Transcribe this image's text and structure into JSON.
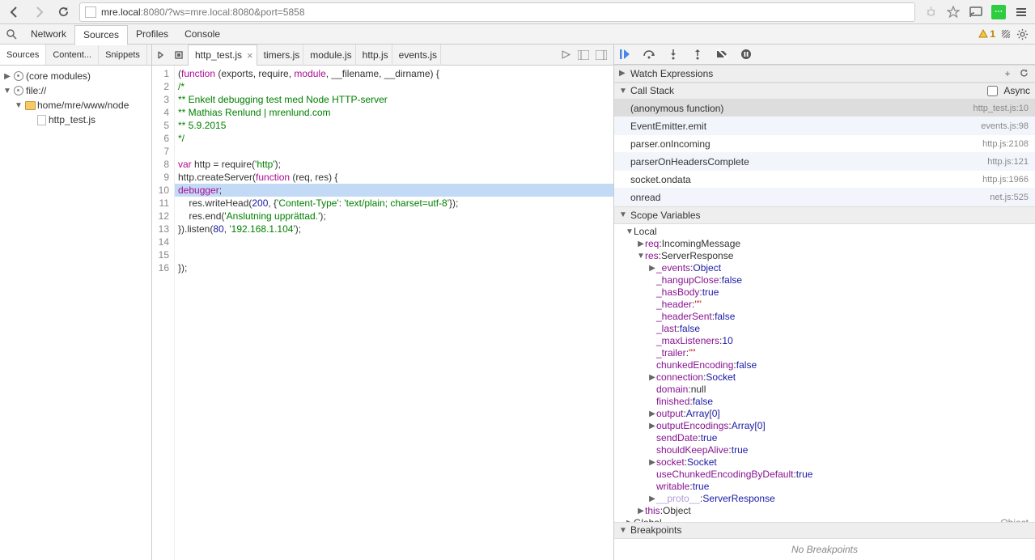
{
  "chrome": {
    "url_host": "mre.local",
    "url_rest": ":8080/?ws=mre.local:8080&port=5858"
  },
  "devtools": {
    "tabs": [
      "Network",
      "Sources",
      "Profiles",
      "Console"
    ],
    "active_tab": "Sources",
    "warn_count": "1"
  },
  "left_panel": {
    "tabs": [
      "Sources",
      "Content...",
      "Snippets"
    ],
    "tree": {
      "core": "(core modules)",
      "file_scheme": "file://",
      "folder_path": "home/mre/www/node",
      "file": "http_test.js"
    }
  },
  "editor": {
    "tabs": [
      "http_test.js",
      "timers.js",
      "module.js",
      "http.js",
      "events.js"
    ],
    "active_tab": "http_test.js",
    "highlighted_line": 10,
    "lines": [
      {
        "n": 1,
        "tokens": [
          [
            "(",
            "p"
          ],
          [
            "function",
            "kw"
          ],
          [
            " (exports, require, ",
            "p"
          ],
          [
            "module",
            "mod"
          ],
          [
            ", __filename, __dirname) {",
            "p"
          ]
        ]
      },
      {
        "n": 2,
        "tokens": [
          [
            "/*",
            "cm"
          ]
        ]
      },
      {
        "n": 3,
        "tokens": [
          [
            "** Enkelt debugging test med Node HTTP-server",
            "cm"
          ]
        ]
      },
      {
        "n": 4,
        "tokens": [
          [
            "** Mathias Renlund | mrenlund.com",
            "cm"
          ]
        ]
      },
      {
        "n": 5,
        "tokens": [
          [
            "** 5.9.2015",
            "cm"
          ]
        ]
      },
      {
        "n": 6,
        "tokens": [
          [
            "*/",
            "cm"
          ]
        ]
      },
      {
        "n": 7,
        "tokens": [
          [
            "",
            "p"
          ]
        ]
      },
      {
        "n": 8,
        "tokens": [
          [
            "var",
            "kw"
          ],
          [
            " http = require(",
            "p"
          ],
          [
            "'http'",
            "str"
          ],
          [
            ");",
            "p"
          ]
        ]
      },
      {
        "n": 9,
        "tokens": [
          [
            "http.createServer(",
            "p"
          ],
          [
            "function",
            "kw"
          ],
          [
            " (req, res) {",
            "p"
          ]
        ]
      },
      {
        "n": 10,
        "tokens": [
          [
            "debugger",
            "kw"
          ],
          [
            ";",
            "p"
          ]
        ]
      },
      {
        "n": 11,
        "tokens": [
          [
            "    res.writeHead(",
            "p"
          ],
          [
            "200",
            "num"
          ],
          [
            ", {",
            "p"
          ],
          [
            "'Content-Type'",
            "str"
          ],
          [
            ": ",
            "p"
          ],
          [
            "'text/plain; charset=utf-8'",
            "str"
          ],
          [
            "});",
            "p"
          ]
        ]
      },
      {
        "n": 12,
        "tokens": [
          [
            "    res.end(",
            "p"
          ],
          [
            "'Anslutning upprättad.'",
            "str"
          ],
          [
            ");",
            "p"
          ]
        ]
      },
      {
        "n": 13,
        "tokens": [
          [
            "}).listen(",
            "p"
          ],
          [
            "80",
            "num"
          ],
          [
            ", ",
            "p"
          ],
          [
            "'192.168.1.104'",
            "str"
          ],
          [
            ");",
            "p"
          ]
        ]
      },
      {
        "n": 14,
        "tokens": [
          [
            "",
            "p"
          ]
        ]
      },
      {
        "n": 15,
        "tokens": [
          [
            "",
            "p"
          ]
        ]
      },
      {
        "n": 16,
        "tokens": [
          [
            "});",
            "p"
          ]
        ]
      }
    ]
  },
  "right_panel": {
    "watch_label": "Watch Expressions",
    "callstack_label": "Call Stack",
    "async_label": "Async",
    "callstack": [
      {
        "fn": "(anonymous function)",
        "loc": "http_test.js:10",
        "active": true
      },
      {
        "fn": "EventEmitter.emit",
        "loc": "events.js:98"
      },
      {
        "fn": "parser.onIncoming",
        "loc": "http.js:2108"
      },
      {
        "fn": "parserOnHeadersComplete",
        "loc": "http.js:121"
      },
      {
        "fn": "socket.ondata",
        "loc": "http.js:1966"
      },
      {
        "fn": "onread",
        "loc": "net.js:525"
      }
    ],
    "scope_label": "Scope Variables",
    "scope": {
      "local": "Local",
      "req": {
        "name": "req",
        "type": "IncomingMessage"
      },
      "res": {
        "name": "res",
        "type": "ServerResponse"
      },
      "res_props": [
        {
          "arrow": "▶",
          "name": "_events",
          "val": "Object",
          "t": "obj"
        },
        {
          "name": "_hangupClose",
          "val": "false",
          "t": "bool"
        },
        {
          "name": "_hasBody",
          "val": "true",
          "t": "bool"
        },
        {
          "name": "_header",
          "val": "\"\"",
          "t": "str"
        },
        {
          "name": "_headerSent",
          "val": "false",
          "t": "bool"
        },
        {
          "name": "_last",
          "val": "false",
          "t": "bool"
        },
        {
          "name": "_maxListeners",
          "val": "10",
          "t": "num"
        },
        {
          "name": "_trailer",
          "val": "\"\"",
          "t": "str"
        },
        {
          "name": "chunkedEncoding",
          "val": "false",
          "t": "bool"
        },
        {
          "arrow": "▶",
          "name": "connection",
          "val": "Socket",
          "t": "obj"
        },
        {
          "name": "domain",
          "val": "null",
          "t": "null"
        },
        {
          "name": "finished",
          "val": "false",
          "t": "bool"
        },
        {
          "arrow": "▶",
          "name": "output",
          "val": "Array[0]",
          "t": "obj"
        },
        {
          "arrow": "▶",
          "name": "outputEncodings",
          "val": "Array[0]",
          "t": "obj"
        },
        {
          "name": "sendDate",
          "val": "true",
          "t": "bool"
        },
        {
          "name": "shouldKeepAlive",
          "val": "true",
          "t": "bool"
        },
        {
          "arrow": "▶",
          "name": "socket",
          "val": "Socket",
          "t": "obj"
        },
        {
          "name": "useChunkedEncodingByDefault",
          "val": "true",
          "t": "bool"
        },
        {
          "name": "writable",
          "val": "true",
          "t": "bool"
        },
        {
          "arrow": "▶",
          "name": "__proto__",
          "val": "ServerResponse",
          "t": "obj",
          "proto": true
        }
      ],
      "this": {
        "name": "this",
        "type": "Object"
      },
      "global": {
        "name": "Global",
        "type": "Object"
      }
    },
    "breakpoints_label": "Breakpoints",
    "breakpoints_empty": "No Breakpoints"
  }
}
